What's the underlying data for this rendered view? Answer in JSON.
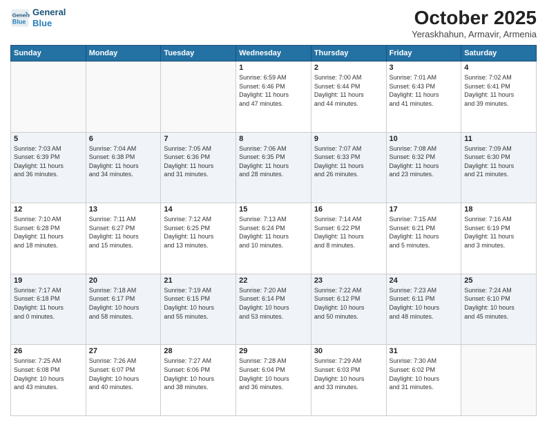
{
  "logo": {
    "line1": "General",
    "line2": "Blue"
  },
  "title": "October 2025",
  "subtitle": "Yeraskhahun, Armavir, Armenia",
  "days_header": [
    "Sunday",
    "Monday",
    "Tuesday",
    "Wednesday",
    "Thursday",
    "Friday",
    "Saturday"
  ],
  "weeks": [
    [
      {
        "num": "",
        "info": ""
      },
      {
        "num": "",
        "info": ""
      },
      {
        "num": "",
        "info": ""
      },
      {
        "num": "1",
        "info": "Sunrise: 6:59 AM\nSunset: 6:46 PM\nDaylight: 11 hours\nand 47 minutes."
      },
      {
        "num": "2",
        "info": "Sunrise: 7:00 AM\nSunset: 6:44 PM\nDaylight: 11 hours\nand 44 minutes."
      },
      {
        "num": "3",
        "info": "Sunrise: 7:01 AM\nSunset: 6:43 PM\nDaylight: 11 hours\nand 41 minutes."
      },
      {
        "num": "4",
        "info": "Sunrise: 7:02 AM\nSunset: 6:41 PM\nDaylight: 11 hours\nand 39 minutes."
      }
    ],
    [
      {
        "num": "5",
        "info": "Sunrise: 7:03 AM\nSunset: 6:39 PM\nDaylight: 11 hours\nand 36 minutes."
      },
      {
        "num": "6",
        "info": "Sunrise: 7:04 AM\nSunset: 6:38 PM\nDaylight: 11 hours\nand 34 minutes."
      },
      {
        "num": "7",
        "info": "Sunrise: 7:05 AM\nSunset: 6:36 PM\nDaylight: 11 hours\nand 31 minutes."
      },
      {
        "num": "8",
        "info": "Sunrise: 7:06 AM\nSunset: 6:35 PM\nDaylight: 11 hours\nand 28 minutes."
      },
      {
        "num": "9",
        "info": "Sunrise: 7:07 AM\nSunset: 6:33 PM\nDaylight: 11 hours\nand 26 minutes."
      },
      {
        "num": "10",
        "info": "Sunrise: 7:08 AM\nSunset: 6:32 PM\nDaylight: 11 hours\nand 23 minutes."
      },
      {
        "num": "11",
        "info": "Sunrise: 7:09 AM\nSunset: 6:30 PM\nDaylight: 11 hours\nand 21 minutes."
      }
    ],
    [
      {
        "num": "12",
        "info": "Sunrise: 7:10 AM\nSunset: 6:28 PM\nDaylight: 11 hours\nand 18 minutes."
      },
      {
        "num": "13",
        "info": "Sunrise: 7:11 AM\nSunset: 6:27 PM\nDaylight: 11 hours\nand 15 minutes."
      },
      {
        "num": "14",
        "info": "Sunrise: 7:12 AM\nSunset: 6:25 PM\nDaylight: 11 hours\nand 13 minutes."
      },
      {
        "num": "15",
        "info": "Sunrise: 7:13 AM\nSunset: 6:24 PM\nDaylight: 11 hours\nand 10 minutes."
      },
      {
        "num": "16",
        "info": "Sunrise: 7:14 AM\nSunset: 6:22 PM\nDaylight: 11 hours\nand 8 minutes."
      },
      {
        "num": "17",
        "info": "Sunrise: 7:15 AM\nSunset: 6:21 PM\nDaylight: 11 hours\nand 5 minutes."
      },
      {
        "num": "18",
        "info": "Sunrise: 7:16 AM\nSunset: 6:19 PM\nDaylight: 11 hours\nand 3 minutes."
      }
    ],
    [
      {
        "num": "19",
        "info": "Sunrise: 7:17 AM\nSunset: 6:18 PM\nDaylight: 11 hours\nand 0 minutes."
      },
      {
        "num": "20",
        "info": "Sunrise: 7:18 AM\nSunset: 6:17 PM\nDaylight: 10 hours\nand 58 minutes."
      },
      {
        "num": "21",
        "info": "Sunrise: 7:19 AM\nSunset: 6:15 PM\nDaylight: 10 hours\nand 55 minutes."
      },
      {
        "num": "22",
        "info": "Sunrise: 7:20 AM\nSunset: 6:14 PM\nDaylight: 10 hours\nand 53 minutes."
      },
      {
        "num": "23",
        "info": "Sunrise: 7:22 AM\nSunset: 6:12 PM\nDaylight: 10 hours\nand 50 minutes."
      },
      {
        "num": "24",
        "info": "Sunrise: 7:23 AM\nSunset: 6:11 PM\nDaylight: 10 hours\nand 48 minutes."
      },
      {
        "num": "25",
        "info": "Sunrise: 7:24 AM\nSunset: 6:10 PM\nDaylight: 10 hours\nand 45 minutes."
      }
    ],
    [
      {
        "num": "26",
        "info": "Sunrise: 7:25 AM\nSunset: 6:08 PM\nDaylight: 10 hours\nand 43 minutes."
      },
      {
        "num": "27",
        "info": "Sunrise: 7:26 AM\nSunset: 6:07 PM\nDaylight: 10 hours\nand 40 minutes."
      },
      {
        "num": "28",
        "info": "Sunrise: 7:27 AM\nSunset: 6:06 PM\nDaylight: 10 hours\nand 38 minutes."
      },
      {
        "num": "29",
        "info": "Sunrise: 7:28 AM\nSunset: 6:04 PM\nDaylight: 10 hours\nand 36 minutes."
      },
      {
        "num": "30",
        "info": "Sunrise: 7:29 AM\nSunset: 6:03 PM\nDaylight: 10 hours\nand 33 minutes."
      },
      {
        "num": "31",
        "info": "Sunrise: 7:30 AM\nSunset: 6:02 PM\nDaylight: 10 hours\nand 31 minutes."
      },
      {
        "num": "",
        "info": ""
      }
    ]
  ]
}
